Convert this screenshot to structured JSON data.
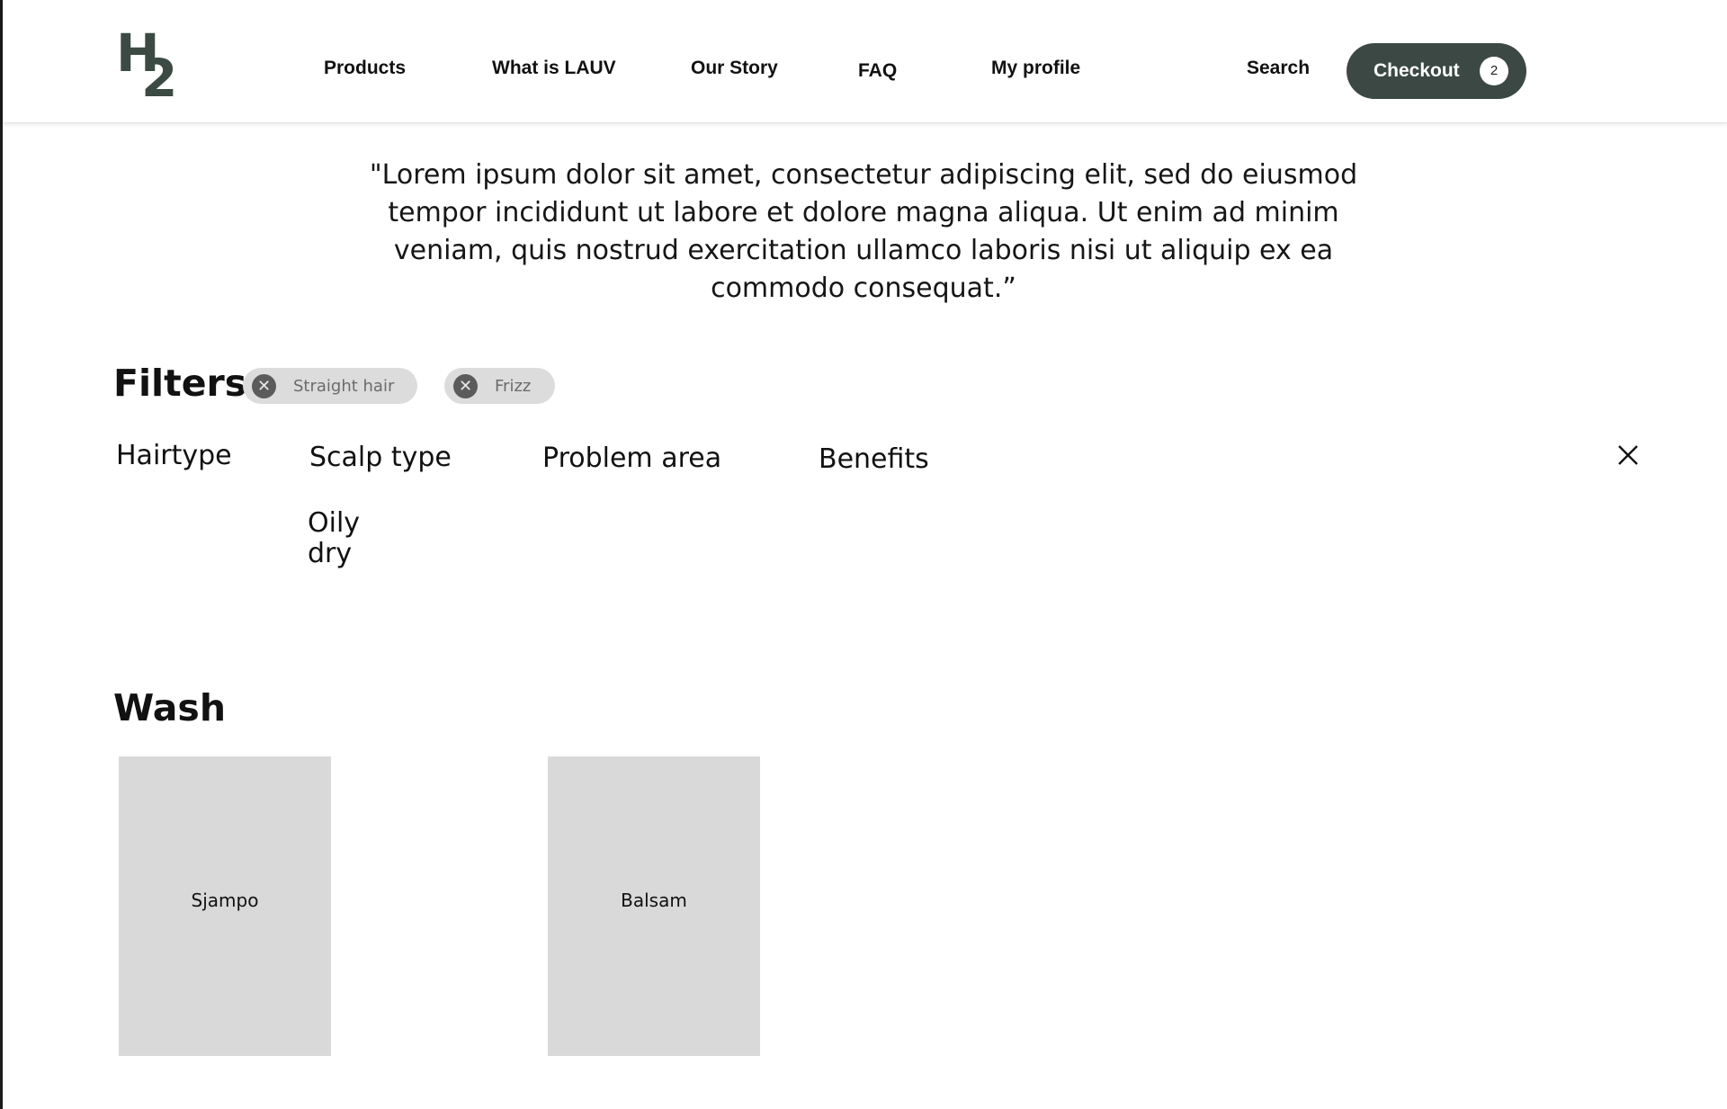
{
  "header": {
    "logo": {
      "letter": "H",
      "subscript": "2"
    },
    "nav": [
      {
        "label": "Products"
      },
      {
        "label": "What is LAUV"
      },
      {
        "label": "Our Story"
      },
      {
        "label": "FAQ"
      },
      {
        "label": "My profile"
      }
    ],
    "search_label": "Search",
    "checkout": {
      "label": "Checkout",
      "count": "2",
      "color": "#3b4843"
    }
  },
  "quote": {
    "text": "\"Lorem ipsum dolor sit amet, consectetur adipiscing elit, sed do eiusmod tempor incididunt ut labore et dolore magna aliqua. Ut enim ad minim veniam, quis nostrud exercitation ullamco laboris nisi ut aliquip ex ea commodo consequat.”"
  },
  "filters": {
    "title": "Filters",
    "active_chips": [
      {
        "label": "Straight hair",
        "remove_icon": "close-circle-icon"
      },
      {
        "label": "Frizz",
        "remove_icon": "close-circle-icon"
      }
    ],
    "categories": [
      {
        "label": "Hairtype"
      },
      {
        "label": "Scalp type",
        "options": [
          "Oily",
          "dry"
        ]
      },
      {
        "label": "Problem area"
      },
      {
        "label": "Benefits"
      }
    ],
    "close_icon": "close-icon"
  },
  "wash": {
    "title": "Wash",
    "products": [
      {
        "name": "Sjampo"
      },
      {
        "name": "Balsam"
      }
    ]
  },
  "colors": {
    "accent": "#3b4843",
    "chip_bg": "#dcdcdc",
    "card_bg": "#d9d9d9"
  }
}
